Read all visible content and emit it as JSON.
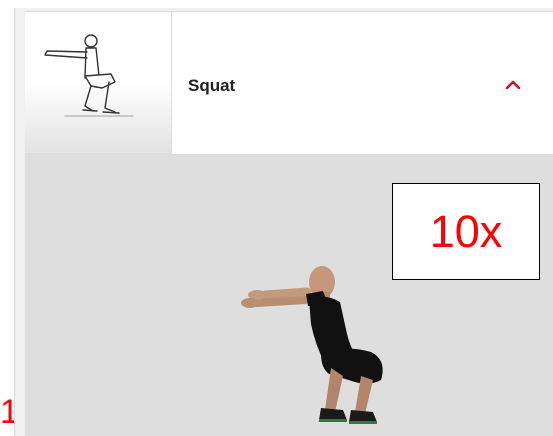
{
  "exercise": {
    "title": "Squat",
    "reps": "10x",
    "step_number": "1"
  },
  "icons": {
    "expand_toggle": "chevron-up-icon"
  },
  "colors": {
    "accent": "#c8102e",
    "reps_text": "#ff0000",
    "media_background": "#dedede"
  }
}
